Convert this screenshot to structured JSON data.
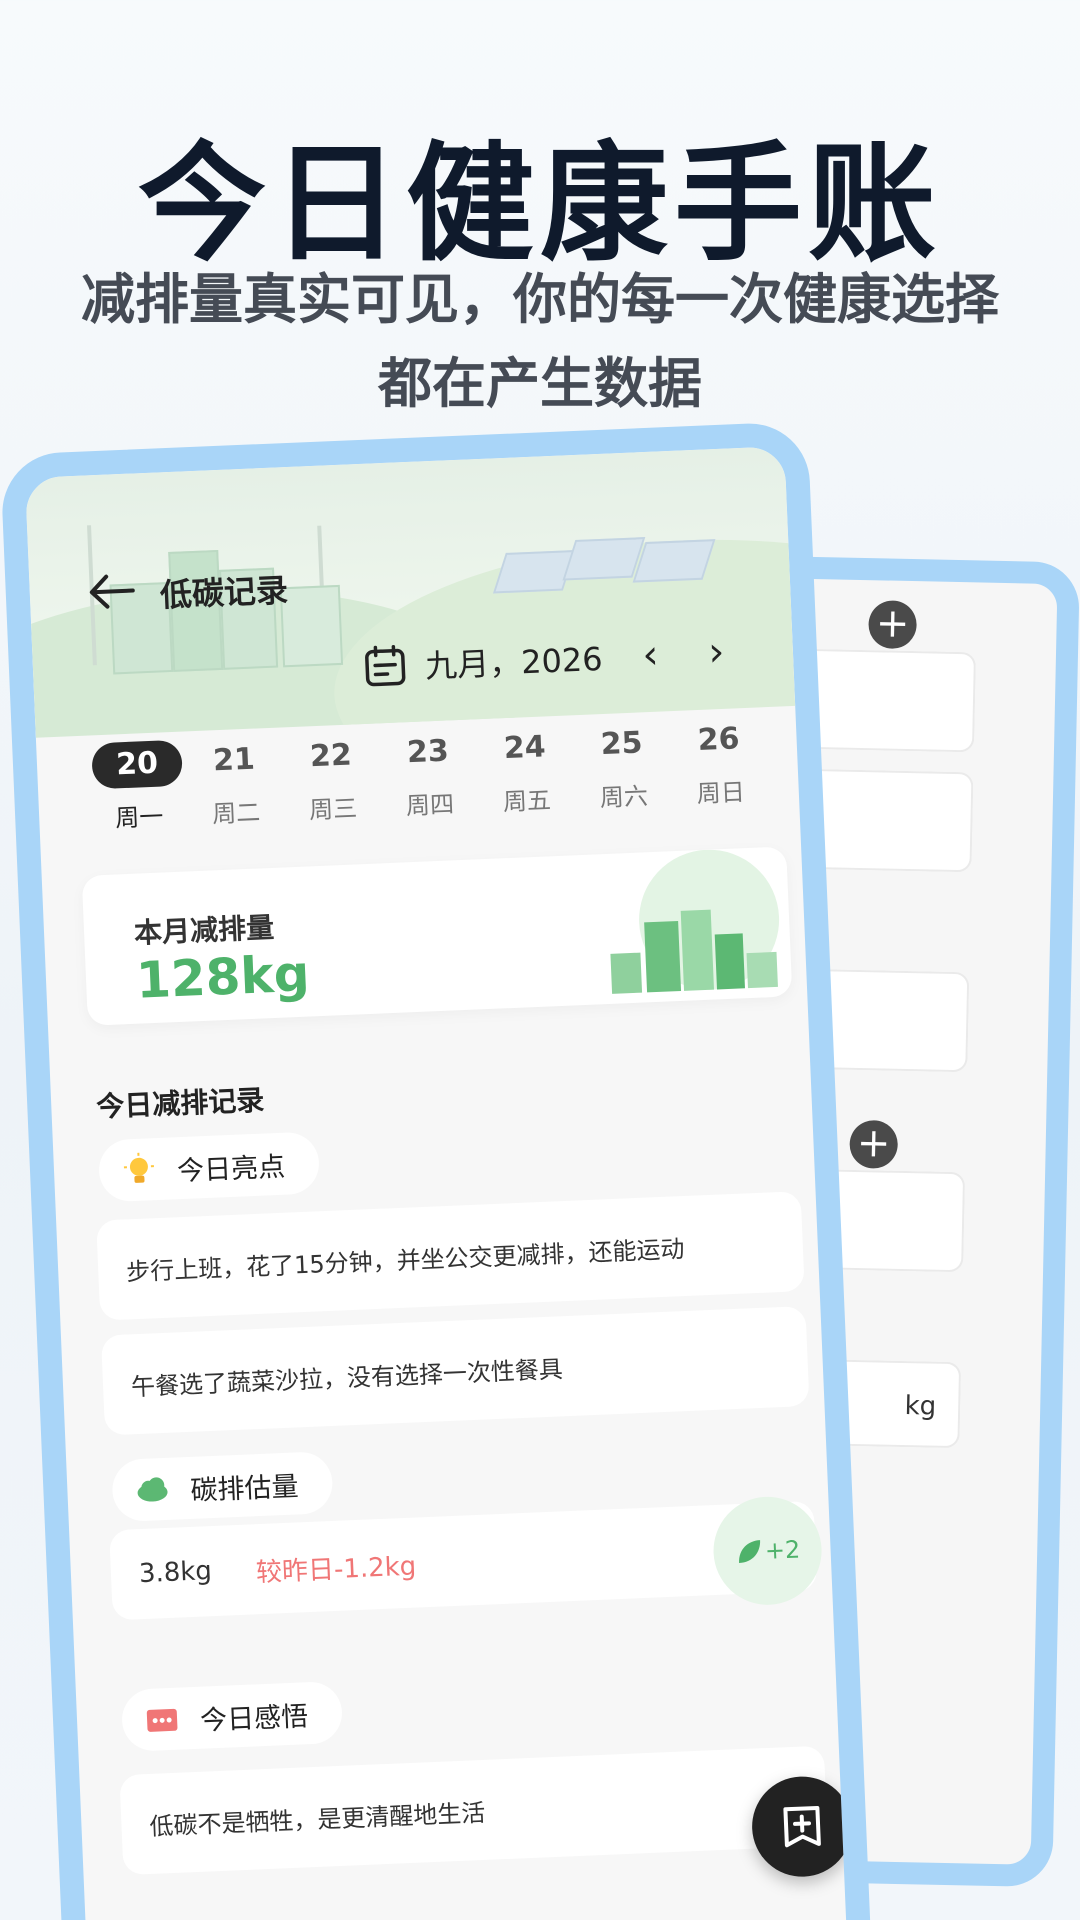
{
  "hero": {
    "title": "今日健康手账",
    "subtitle_line1": "减排量真实可见，你的每一次健康选择",
    "subtitle_line2": "都在产生数据"
  },
  "nav": {
    "back_icon": "arrow-left-icon",
    "title": "低碳记录"
  },
  "calendar": {
    "month_label": "九月，2026",
    "days": [
      {
        "num": "20",
        "weekday": "周一",
        "selected": true
      },
      {
        "num": "21",
        "weekday": "周二",
        "selected": false
      },
      {
        "num": "22",
        "weekday": "周三",
        "selected": false
      },
      {
        "num": "23",
        "weekday": "周四",
        "selected": false
      },
      {
        "num": "24",
        "weekday": "周五",
        "selected": false
      },
      {
        "num": "25",
        "weekday": "周六",
        "selected": false
      },
      {
        "num": "26",
        "weekday": "周日",
        "selected": false
      }
    ]
  },
  "monthly": {
    "label": "本月减排量",
    "value": "128kg"
  },
  "today": {
    "section_title": "今日减排记录",
    "highlight_label": "今日亮点",
    "highlights": [
      "步行上班，花了15分钟，并坐公交更减排，还能运动",
      "午餐选了蔬菜沙拉，没有选择一次性餐具"
    ],
    "carbon_label": "碳排估量",
    "carbon_value": "3.8kg",
    "carbon_compare": "较昨日-1.2kg",
    "carbon_badge": "+2",
    "insight_label": "今日感悟",
    "insight_text": "低碳不是牺牲，是更清醒地生活"
  },
  "back_phone": {
    "unit": "kg"
  },
  "colors": {
    "frame": "#a9d5f8",
    "accent_green": "#4eb26a",
    "compare_red": "#f07676"
  }
}
